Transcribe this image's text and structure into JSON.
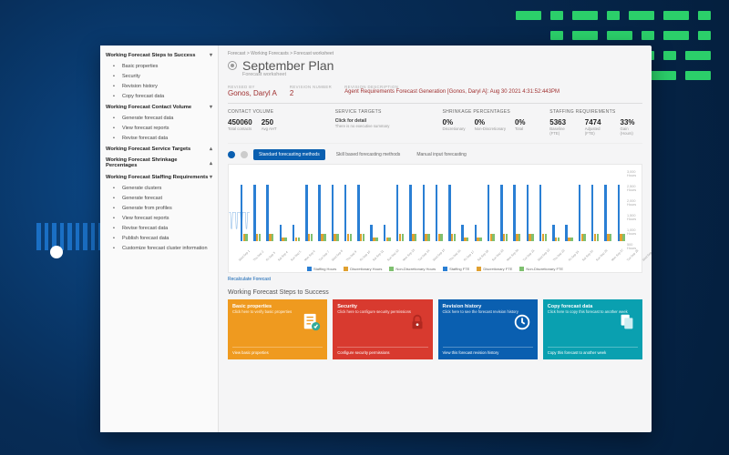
{
  "breadcrumb": "Forecast > Working Forecasts > Forecast worksheet",
  "title": "September Plan",
  "subtitle": "Forecast worksheet",
  "sidebar": {
    "groups": [
      {
        "label": "Working Forecast Steps to Success",
        "open": true,
        "items": [
          "Basic properties",
          "Security",
          "Revision history",
          "Copy forecast data"
        ]
      },
      {
        "label": "Working Forecast Contact Volume",
        "open": true,
        "items": [
          "Generate forecast data",
          "View forecast reports",
          "Revise forecast data"
        ]
      },
      {
        "label": "Working Forecast Service Targets",
        "open": false,
        "items": []
      },
      {
        "label": "Working Forecast Shrinkage Percentages",
        "open": false,
        "items": []
      },
      {
        "label": "Working Forecast Staffing Requirements",
        "open": true,
        "items": [
          "Generate clusters",
          "Generate forecast",
          "Generate from profiles",
          "View forecast reports",
          "Revise forecast data",
          "Publish forecast data",
          "Customize forecast cluster information"
        ]
      }
    ]
  },
  "run": {
    "author_label": "REVISED BY",
    "author": "Gonos, Daryl A",
    "num_label": "REVISION NUMBER",
    "num": "2",
    "desc_label": "REVISION DESCRIPTION",
    "desc": "Agent Requirements Forecast Generation [Gonos, Daryl A]: Aug 30 2021 4:31:52:443PM"
  },
  "stats": {
    "contact": {
      "head": "CONTACT VOLUME",
      "a": "450060",
      "a_sub": "Total contacts",
      "b": "250",
      "b_sub": "Avg AHT"
    },
    "service": {
      "head": "SERVICE TARGETS",
      "note": "Click for detail",
      "note2": "There is no executive summary"
    },
    "shrink": {
      "head": "SHRINKAGE PERCENTAGES",
      "a": "0%",
      "a_sub": "Discretionary",
      "b": "0%",
      "b_sub": "Non-Discretionary",
      "c": "0%",
      "c_sub": "Total"
    },
    "staff": {
      "head": "STAFFING REQUIREMENTS",
      "a": "5363",
      "a_sub": "Baseline (FTE)",
      "b": "7474",
      "b_sub": "Adjusted (FTE)",
      "c": "33%",
      "c_sub": "Gain (Hours)"
    }
  },
  "tabs": {
    "a": "Standard forecasting methods",
    "b": "Skill based forecasting methods",
    "c": "Manual input forecasting"
  },
  "chart_data": {
    "type": "bar",
    "categories": [
      "Wed Sep 1",
      "Thu Sep 2",
      "Fri Sep 3",
      "Sat Sep 4",
      "Sun Sep 5",
      "Mon Sep 6",
      "Tue Sep 7",
      "Wed Sep 8",
      "Thu Sep 9",
      "Fri Sep 10",
      "Sat Sep 11",
      "Sun Sep 12",
      "Mon Sep 13",
      "Tue Sep 14",
      "Wed Sep 15",
      "Thu Sep 16",
      "Fri Sep 17",
      "Sat Sep 18",
      "Sun Sep 19",
      "Mon Sep 20",
      "Tue Sep 21",
      "Wed Sep 22",
      "Thu Sep 23",
      "Fri Sep 24",
      "Sat Sep 25",
      "Sun Sep 26",
      "Mon Sep 27",
      "Tue Sep 28",
      "Wed Sep 29",
      "Thu Sep 30"
    ],
    "series": [
      {
        "name": "Staffing Hours",
        "color": "#2a7fd4",
        "values": [
          2400,
          2400,
          2400,
          700,
          700,
          2400,
          2400,
          2400,
          2400,
          2400,
          700,
          700,
          2400,
          2400,
          2400,
          2400,
          2400,
          700,
          700,
          2400,
          2400,
          2400,
          2400,
          2400,
          700,
          700,
          2400,
          2400,
          2400,
          2400
        ]
      },
      {
        "name": "Discretionary Hours",
        "color": "#e0a030",
        "values": [
          300,
          300,
          300,
          150,
          150,
          300,
          300,
          300,
          300,
          300,
          150,
          150,
          300,
          300,
          300,
          300,
          300,
          150,
          150,
          300,
          300,
          300,
          300,
          300,
          150,
          150,
          300,
          300,
          300,
          300
        ]
      },
      {
        "name": "Non-Discretionary Hours",
        "color": "#7fc070",
        "values": [
          300,
          300,
          300,
          150,
          150,
          300,
          300,
          300,
          300,
          300,
          150,
          150,
          300,
          300,
          300,
          300,
          300,
          150,
          150,
          300,
          300,
          300,
          300,
          300,
          150,
          150,
          300,
          300,
          300,
          300
        ]
      },
      {
        "name": "Staffing FTE",
        "color": "#2a7fd4",
        "line": true,
        "values": [
          300,
          300,
          300,
          90,
          90,
          300,
          300,
          300,
          300,
          300,
          90,
          90,
          300,
          300,
          300,
          300,
          300,
          90,
          90,
          300,
          300,
          300,
          300,
          300,
          90,
          90,
          300,
          300,
          300,
          300
        ]
      }
    ],
    "y_left_ticks": [
      "3,000 Hours",
      "2,500 Hours",
      "2,000 Hours",
      "1,500 Hours",
      "1,000 Hours",
      "500 Hours"
    ],
    "legend_extra": [
      "Discretionary FTE",
      "Non-Discretionary FTE"
    ]
  },
  "recalc": "Recalculate Forecast",
  "steps_head": "Working Forecast Steps to Success",
  "tiles": {
    "basic": {
      "title": "Basic properties",
      "body": "Click here to verify basic properties",
      "foot": "View basic properties"
    },
    "security": {
      "title": "Security",
      "body": "Click here to configure security permissions",
      "foot": "Configure security permissions"
    },
    "history": {
      "title": "Revision history",
      "body": "Click here to see the forecast revision history",
      "foot": "View this forecast revision history"
    },
    "copy": {
      "title": "Copy forecast data",
      "body": "Click here to copy this forecast to another week",
      "foot": "Copy this forecast to another week"
    }
  }
}
